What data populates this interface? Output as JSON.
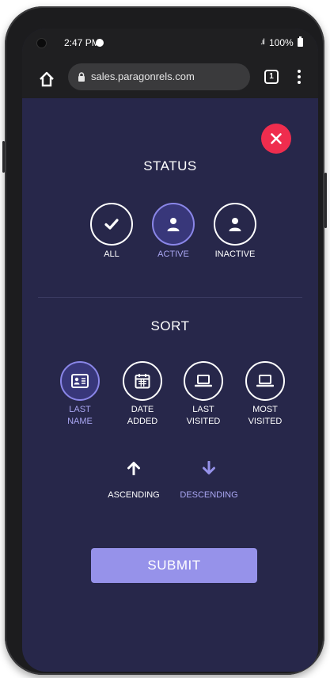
{
  "status_bar": {
    "time": "2:47 PM",
    "battery": "100%",
    "signal": ".ıl"
  },
  "browser": {
    "url": "sales.paragonrels.com",
    "tab_count": "1"
  },
  "status_section": {
    "title": "STATUS",
    "options": [
      {
        "label": "ALL",
        "icon": "check-icon",
        "selected": false
      },
      {
        "label": "ACTIVE",
        "icon": "user-icon",
        "selected": true
      },
      {
        "label": "INACTIVE",
        "icon": "user-icon",
        "selected": false
      }
    ]
  },
  "sort_section": {
    "title": "SORT",
    "options": [
      {
        "line1": "LAST",
        "line2": "NAME",
        "icon": "id-card-icon",
        "selected": true
      },
      {
        "line1": "DATE",
        "line2": "ADDED",
        "icon": "calendar-icon",
        "selected": false
      },
      {
        "line1": "LAST",
        "line2": "VISITED",
        "icon": "laptop-icon",
        "selected": false
      },
      {
        "line1": "MOST",
        "line2": "VISITED",
        "icon": "laptop-icon",
        "selected": false
      }
    ],
    "direction": [
      {
        "label": "ASCENDING",
        "icon": "arrow-up-icon",
        "selected": false
      },
      {
        "label": "DESCENDING",
        "icon": "arrow-down-icon",
        "selected": true
      }
    ]
  },
  "submit_label": "SUBMIT",
  "colors": {
    "background": "#27274a",
    "accent": "#9692ea",
    "accent_text": "#a9a6f2",
    "close": "#ef2d4e",
    "text": "#ffffff"
  }
}
